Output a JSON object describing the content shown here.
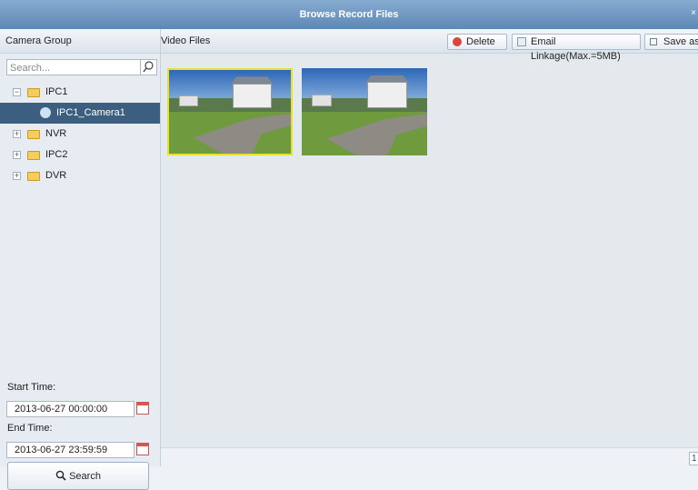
{
  "window": {
    "title": "Browse Record Files",
    "close_label": "×"
  },
  "left_panel": {
    "header": "Camera Group",
    "search_placeholder": "Search...",
    "tree": [
      {
        "label": "IPC1",
        "expanded": true,
        "expander": "−",
        "children": [
          {
            "label": "IPC1_Camera1",
            "selected": true
          }
        ]
      },
      {
        "label": "NVR",
        "expanded": false,
        "expander": "+"
      },
      {
        "label": "IPC2",
        "expanded": false,
        "expander": "+"
      },
      {
        "label": "DVR",
        "expanded": false,
        "expander": "+"
      }
    ],
    "start_time_label": "Start Time:",
    "start_time_value": "2013-06-27 00:00:00",
    "end_time_label": "End Time:",
    "end_time_value": "2013-06-27 23:59:59",
    "search_button": "Search"
  },
  "right_panel": {
    "header": "Video Files",
    "toolbar": {
      "delete_label": "Delete",
      "email_label": "Email Linkage(Max.=5MB)",
      "save_label": "Save as"
    },
    "thumbnails": [
      {
        "selected": true
      },
      {
        "selected": false
      }
    ],
    "page_number": "1"
  },
  "colors": {
    "title_bar": "#6d95c0",
    "selection": "#3c5f80",
    "thumbnail_highlight": "#e6e12f",
    "delete_icon": "#d9463b"
  }
}
